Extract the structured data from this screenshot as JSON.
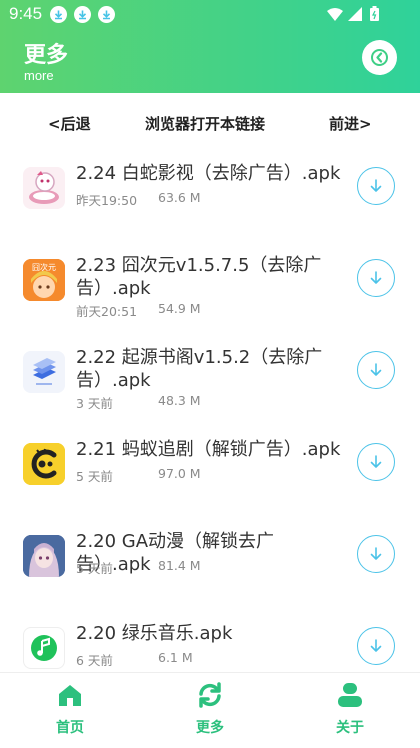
{
  "status_bar": {
    "time": "9:45",
    "download_notifications": 3
  },
  "header": {
    "title": "更多",
    "subtitle": "more"
  },
  "browser_nav": {
    "back_label": "<后退",
    "open_label": "浏览器打开本链接",
    "forward_label": "前进>"
  },
  "apps": [
    {
      "name": "2.24 白蛇影视（去除广告）.apk",
      "date": "昨天19:50",
      "size": "63.6 M",
      "icon": "white-snake-icon"
    },
    {
      "name": "2.23 囧次元v1.5.7.5（去除广告）.apk",
      "date": "前天20:51",
      "size": "54.9 M",
      "icon": "jiongciyuan-icon",
      "icon_text": "囧次元"
    },
    {
      "name": "2.22 起源书阁v1.5.2（去除广告）.apk",
      "date": "3 天前",
      "size": "48.3 M",
      "icon": "book-icon"
    },
    {
      "name": "2.21 蚂蚁追剧（解锁广告）.apk",
      "date": "5 天前",
      "size": "97.0 M",
      "icon": "ant-icon"
    },
    {
      "name": "2.20 GA动漫（解锁去广告）.apk",
      "date": "5 天前",
      "size": "81.4 M",
      "icon": "anime-girl-icon"
    },
    {
      "name": "2.20 绿乐音乐.apk",
      "date": "6 天前",
      "size": "6.1 M",
      "icon": "music-note-icon"
    }
  ],
  "bottom_nav": [
    {
      "label": "首页",
      "icon": "home-icon"
    },
    {
      "label": "更多",
      "icon": "refresh-icon"
    },
    {
      "label": "关于",
      "icon": "user-icon"
    }
  ],
  "colors": {
    "brand_green": "#2fd29a",
    "accent_green": "#2cc07e",
    "download_blue": "#4cc3e8"
  }
}
